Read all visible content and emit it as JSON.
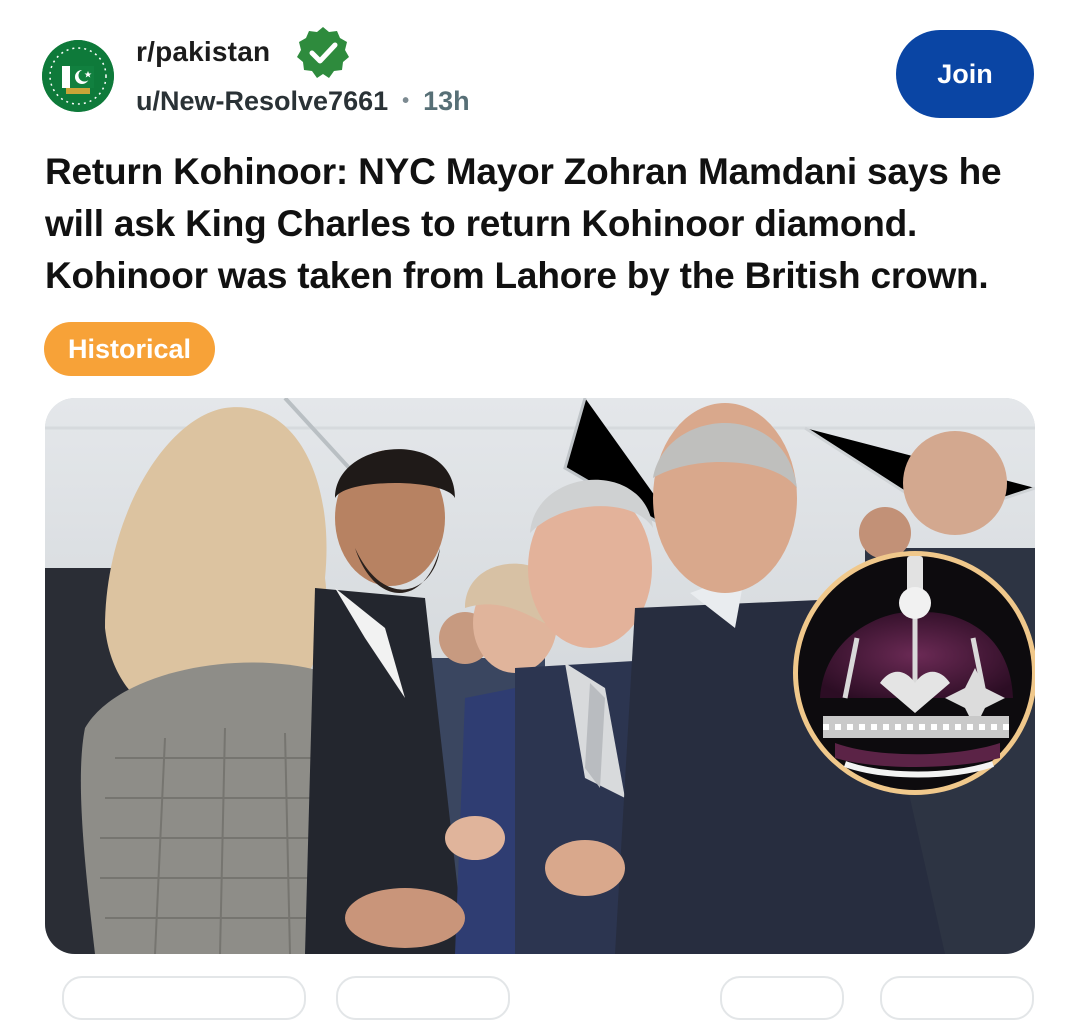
{
  "subreddit": {
    "name": "r/pakistan",
    "icon": "pakistan-flag-icon",
    "verified_icon": "verified-check-icon"
  },
  "post": {
    "author": "u/New-Resolve7661",
    "separator": "•",
    "age": "13h",
    "title": "Return Kohinoor: NYC Mayor Zohran Mamdani says he will ask King Charles to return Kohinoor diamond. Kohinoor was taken from Lahore by the British crown.",
    "flair": "Historical"
  },
  "actions": {
    "join_label": "Join"
  },
  "colors": {
    "join": "#0a45a4",
    "flair": "#f7a238",
    "verified": "#2e8b3d",
    "avatar": "#0e7a3a"
  }
}
